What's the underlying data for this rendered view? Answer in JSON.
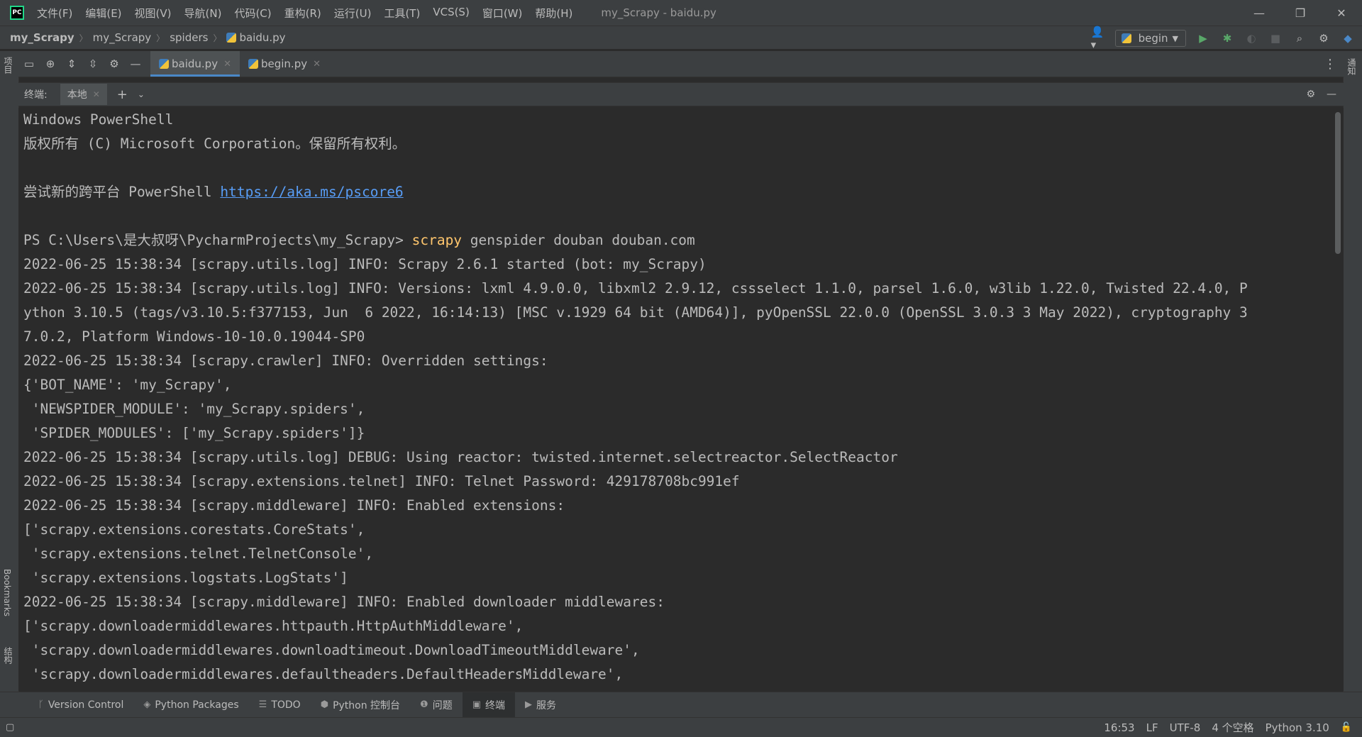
{
  "window": {
    "menu": [
      "文件(F)",
      "编辑(E)",
      "视图(V)",
      "导航(N)",
      "代码(C)",
      "重构(R)",
      "运行(U)",
      "工具(T)",
      "VCS(S)",
      "窗口(W)",
      "帮助(H)"
    ],
    "title": "my_Scrapy - baidu.py",
    "controls": {
      "minimize": "—",
      "restore": "❐",
      "close": "✕"
    }
  },
  "breadcrumb": {
    "project": "my_Scrapy",
    "folder": "my_Scrapy",
    "subfolder": "spiders",
    "file": "baidu.py"
  },
  "run_config": {
    "name": "begin"
  },
  "left_stripe": {
    "project_label": "项目",
    "bookmarks_label": "Bookmarks",
    "structure_label": "结构"
  },
  "right_stripe": {
    "notifications_label": "通知"
  },
  "editor_tabs": [
    {
      "label": "baidu.py",
      "active": true
    },
    {
      "label": "begin.py",
      "active": false
    }
  ],
  "terminal": {
    "header_label": "终端:",
    "tab_label": "本地",
    "lines": [
      {
        "text": "Windows PowerShell"
      },
      {
        "text": "版权所有 (C) Microsoft Corporation。保留所有权利。"
      },
      {
        "text": ""
      },
      {
        "pre": "尝试新的跨平台 PowerShell ",
        "link": "https://aka.ms/pscore6"
      },
      {
        "text": ""
      },
      {
        "pre": "PS C:\\Users\\是大叔呀\\PycharmProjects\\my_Scrapy> ",
        "cmd": "scrapy",
        "post": " genspider douban douban.com"
      },
      {
        "text": "2022-06-25 15:38:34 [scrapy.utils.log] INFO: Scrapy 2.6.1 started (bot: my_Scrapy)"
      },
      {
        "text": "2022-06-25 15:38:34 [scrapy.utils.log] INFO: Versions: lxml 4.9.0.0, libxml2 2.9.12, cssselect 1.1.0, parsel 1.6.0, w3lib 1.22.0, Twisted 22.4.0, P"
      },
      {
        "text": "ython 3.10.5 (tags/v3.10.5:f377153, Jun  6 2022, 16:14:13) [MSC v.1929 64 bit (AMD64)], pyOpenSSL 22.0.0 (OpenSSL 3.0.3 3 May 2022), cryptography 3"
      },
      {
        "text": "7.0.2, Platform Windows-10-10.0.19044-SP0"
      },
      {
        "text": "2022-06-25 15:38:34 [scrapy.crawler] INFO: Overridden settings:"
      },
      {
        "text": "{'BOT_NAME': 'my_Scrapy',"
      },
      {
        "text": " 'NEWSPIDER_MODULE': 'my_Scrapy.spiders',"
      },
      {
        "text": " 'SPIDER_MODULES': ['my_Scrapy.spiders']}"
      },
      {
        "text": "2022-06-25 15:38:34 [scrapy.utils.log] DEBUG: Using reactor: twisted.internet.selectreactor.SelectReactor"
      },
      {
        "text": "2022-06-25 15:38:34 [scrapy.extensions.telnet] INFO: Telnet Password: 429178708bc991ef"
      },
      {
        "text": "2022-06-25 15:38:34 [scrapy.middleware] INFO: Enabled extensions:"
      },
      {
        "text": "['scrapy.extensions.corestats.CoreStats',"
      },
      {
        "text": " 'scrapy.extensions.telnet.TelnetConsole',"
      },
      {
        "text": " 'scrapy.extensions.logstats.LogStats']"
      },
      {
        "text": "2022-06-25 15:38:34 [scrapy.middleware] INFO: Enabled downloader middlewares:"
      },
      {
        "text": "['scrapy.downloadermiddlewares.httpauth.HttpAuthMiddleware',"
      },
      {
        "text": " 'scrapy.downloadermiddlewares.downloadtimeout.DownloadTimeoutMiddleware',"
      },
      {
        "text": " 'scrapy.downloadermiddlewares.defaultheaders.DefaultHeadersMiddleware',"
      }
    ]
  },
  "tool_windows": [
    {
      "label": "Version Control",
      "icon": "branch-icon",
      "active": false
    },
    {
      "label": "Python Packages",
      "icon": "layers-icon",
      "active": false
    },
    {
      "label": "TODO",
      "icon": "list-icon",
      "active": false
    },
    {
      "label": "Python 控制台",
      "icon": "python-icon",
      "active": false
    },
    {
      "label": "问题",
      "icon": "problems-icon",
      "active": false
    },
    {
      "label": "终端",
      "icon": "terminal-icon",
      "active": true
    },
    {
      "label": "服务",
      "icon": "services-icon",
      "active": false
    }
  ],
  "status": {
    "position": "16:53",
    "line_sep": "LF",
    "encoding": "UTF-8",
    "indent": "4 个空格",
    "interpreter": "Python 3.10"
  }
}
